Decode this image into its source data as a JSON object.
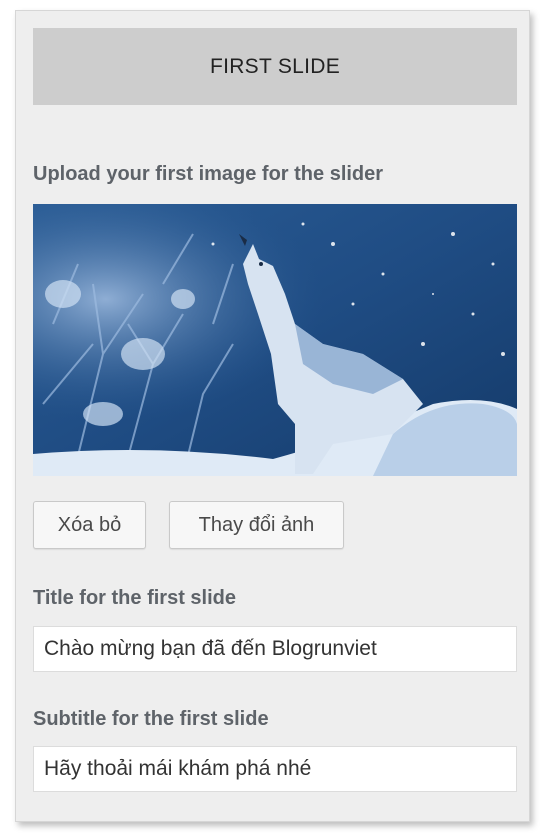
{
  "slide": {
    "header": "FIRST SLIDE",
    "image_label": "Upload your first image for the slider",
    "remove_button": "Xóa bỏ",
    "change_button": "Thay đổi ảnh",
    "title_label": "Title for the first slide",
    "title_value": "Chào mừng bạn đã đến Blogrunviet",
    "subtitle_label": "Subtitle for the first slide",
    "subtitle_value": "Hãy thoải mái khám phá nhé"
  },
  "image": {
    "subject": "howling-wolf-in-snowy-forest"
  },
  "colors": {
    "panel_bg": "#eeeeee",
    "header_bg": "#cdcdcd",
    "label_text": "#5e6369",
    "image_dark": "#1e4a7e",
    "image_light": "#dfeaf6"
  }
}
